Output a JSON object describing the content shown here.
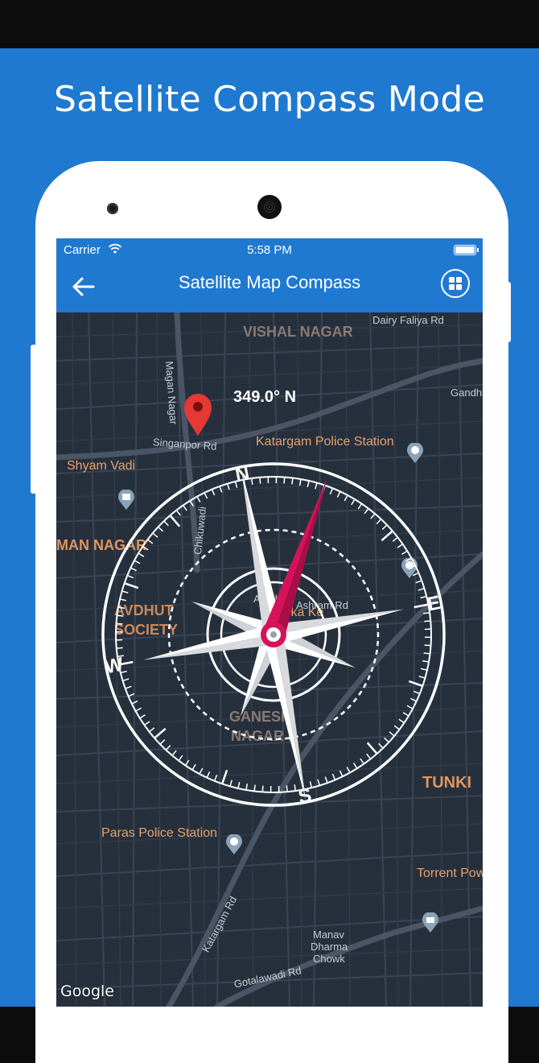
{
  "headline": "Satellite Compass Mode",
  "status": {
    "carrier": "Carrier",
    "time": "5:58 PM"
  },
  "navbar": {
    "title": "Satellite Map Compass"
  },
  "compass": {
    "heading": "349.0° N",
    "heading_deg": 349,
    "dirs": {
      "n": "N",
      "e": "E",
      "s": "S",
      "w": "W"
    }
  },
  "map": {
    "labels": {
      "vishal_nagar": "VISHAL NAGAR",
      "dairy_faliya": "Dairy Faliya Rd",
      "magan_nagar": "Magan Nagar",
      "gandhi": "Gandhi",
      "singanpor": "Singanpor Rd",
      "katargam_police": "Katargam Police Station",
      "shyam_vadi": "Shyam Vadi",
      "man_nagar": "MAN NAGAR",
      "chikuwadi": "Chikuwadi",
      "avdhut": "AVDHUT",
      "society": "SOCIETY",
      "anath": "Anath",
      "ashram": "Ashram Rd",
      "ambika": "Ambika Ke",
      "ganesh": "GANESH",
      "nagar_i": "NAGAR I",
      "tunki": "TUNKI",
      "paras_police": "Paras Police Station",
      "torrent": "Torrent Pow",
      "katargam_rd": "Katargam Rd",
      "manav": "Manav",
      "dharma": "Dharma",
      "chowk": "Chowk",
      "gotalawadi": "Gotalawadi Rd"
    },
    "attribution": "Google"
  },
  "colors": {
    "brand": "#1f79d1",
    "map_bg": "#26303d",
    "needle": "#d4135a",
    "pin": "#e53935"
  }
}
